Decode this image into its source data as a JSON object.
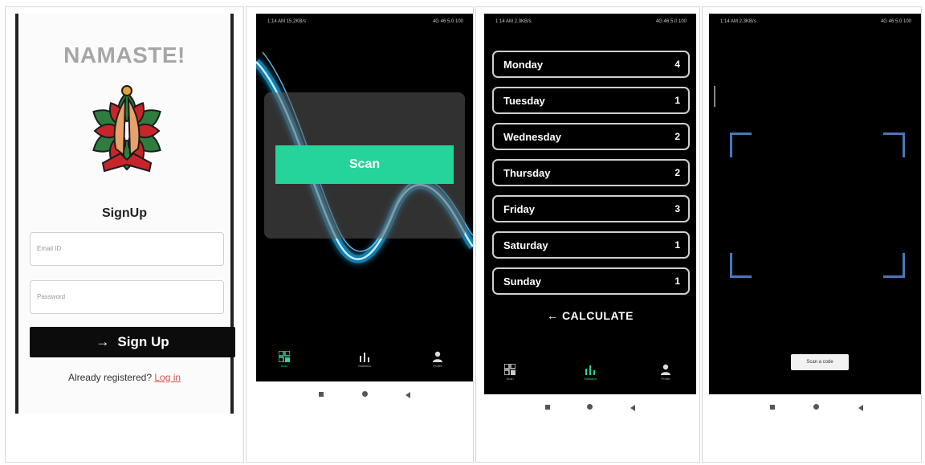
{
  "signup": {
    "app_title": "NAMASTE!",
    "heading": "SignUp",
    "email_placeholder": "Email ID",
    "password_placeholder": "Password",
    "button_label": "Sign Up",
    "button_icon": "arrow-right-icon",
    "already_text": "Already registered?",
    "login_link": "Log in"
  },
  "scan_screen": {
    "status_left": "1:14 AM 15.2KB/s",
    "status_right": "4G 46 5.0 100",
    "scan_button": "Scan",
    "accent": "#25d49a",
    "nav": [
      {
        "label": "Scan",
        "icon": "qr-code-icon",
        "active": true
      },
      {
        "label": "Statistics",
        "icon": "bar-chart-icon",
        "active": false
      },
      {
        "label": "Profile",
        "icon": "person-icon",
        "active": false
      }
    ]
  },
  "days_screen": {
    "status_left": "1:14 AM 2.3KB/s",
    "status_right": "4G 46 5.0 100",
    "days": [
      {
        "name": "Monday",
        "count": "4"
      },
      {
        "name": "Tuesday",
        "count": "1"
      },
      {
        "name": "Wednesday",
        "count": "2"
      },
      {
        "name": "Thursday",
        "count": "2"
      },
      {
        "name": "Friday",
        "count": "3"
      },
      {
        "name": "Saturday",
        "count": "1"
      },
      {
        "name": "Sunday",
        "count": "1"
      }
    ],
    "calculate_label": "CALCULATE",
    "calculate_icon": "arrow-left-icon",
    "nav": [
      {
        "label": "Scan",
        "icon": "qr-code-icon",
        "active": false
      },
      {
        "label": "Statistics",
        "icon": "bar-chart-icon",
        "active": true
      },
      {
        "label": "Profile",
        "icon": "person-icon",
        "active": false
      }
    ]
  },
  "camera_screen": {
    "status_left": "1:14 AM 2.3KB/s",
    "status_right": "4G 46 5.0 100",
    "toast": "Scan a code"
  }
}
